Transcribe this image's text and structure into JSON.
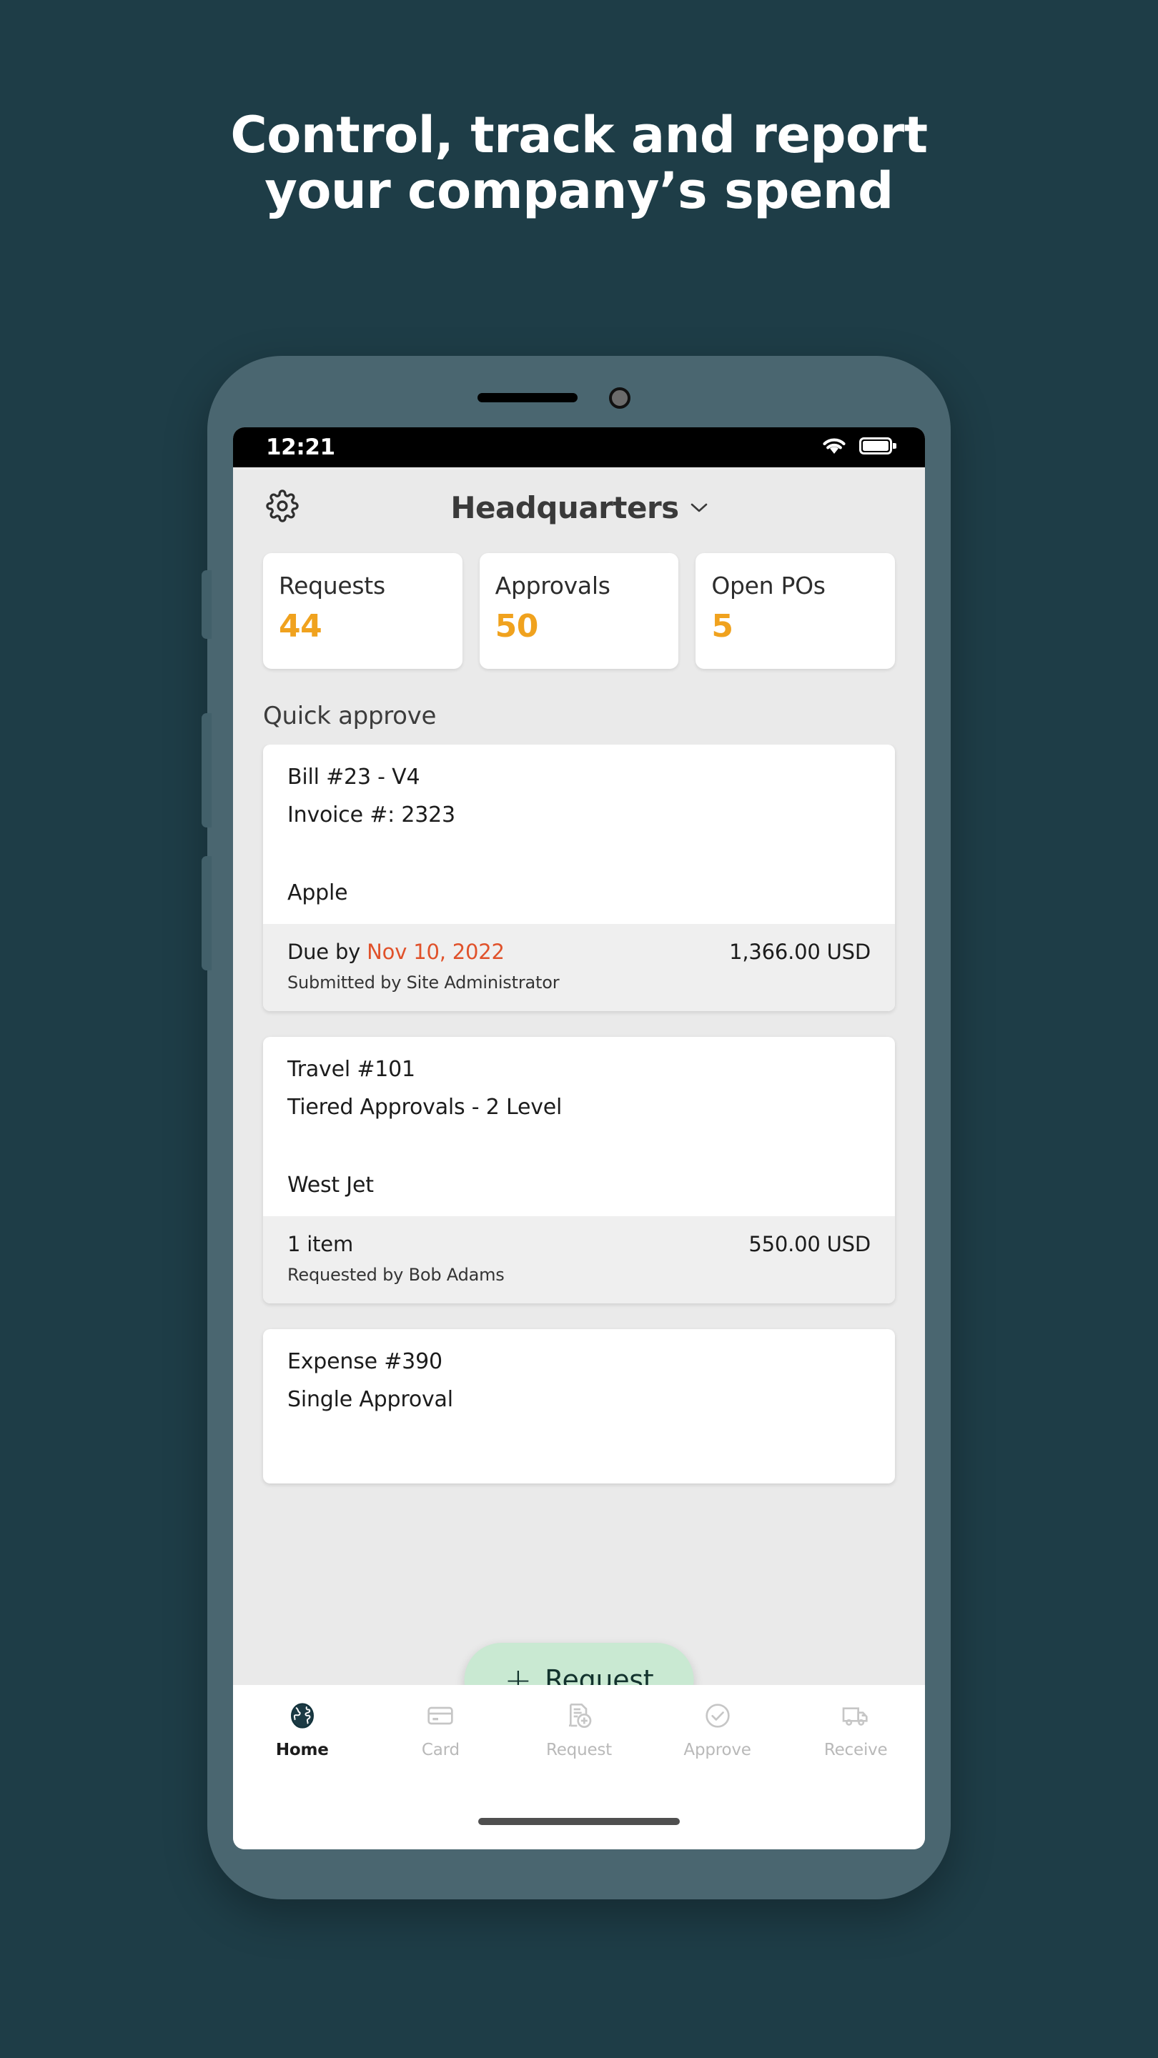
{
  "headline": {
    "line1": "Control, track and report",
    "line2": "your company’s spend"
  },
  "colors": {
    "page_background": "#1E3D47",
    "phone_frame": "#4A6670",
    "screen_background": "#EAEAEA",
    "accent_amber": "#F0A21E",
    "due_date_red": "#E0522B",
    "fab_mint": "#C9E9D2",
    "nav_active": "#1C3A44",
    "nav_inactive": "#B9B9B9"
  },
  "status_bar": {
    "time": "12:21",
    "wifi_icon": "wifi-icon",
    "battery_icon": "battery-full-icon"
  },
  "header": {
    "settings_icon": "gear-icon",
    "title": "Headquarters",
    "chevron_icon": "chevron-down-icon"
  },
  "stats": [
    {
      "label": "Requests",
      "value": "44"
    },
    {
      "label": "Approvals",
      "value": "50"
    },
    {
      "label": "Open POs",
      "value": "5"
    }
  ],
  "quick_approve": {
    "section_title": "Quick approve",
    "cards": [
      {
        "title": "Bill #23 - V4",
        "subtitle": "Invoice #: 2323",
        "vendor": "Apple",
        "meta_prefix": "Due by ",
        "meta_date": "Nov 10, 2022",
        "amount": "1,366.00 USD",
        "submitted_by": "Submitted by Site Administrator"
      },
      {
        "title": "Travel #101",
        "subtitle": "Tiered Approvals - 2 Level",
        "vendor": "West Jet",
        "meta_prefix": "1 item",
        "meta_date": "",
        "amount": "550.00 USD",
        "submitted_by": "Requested by Bob Adams"
      },
      {
        "title": "Expense #390",
        "subtitle": "Single Approval",
        "vendor": "",
        "meta_prefix": "",
        "meta_date": "",
        "amount": "",
        "submitted_by": ""
      }
    ]
  },
  "fab": {
    "plus_icon": "plus-icon",
    "label": "Request"
  },
  "bottom_nav": [
    {
      "label": "Home",
      "icon": "globe-icon",
      "active": true
    },
    {
      "label": "Card",
      "icon": "credit-card-icon",
      "active": false
    },
    {
      "label": "Request",
      "icon": "document-plus-icon",
      "active": false
    },
    {
      "label": "Approve",
      "icon": "check-circle-icon",
      "active": false
    },
    {
      "label": "Receive",
      "icon": "delivery-truck-icon",
      "active": false
    }
  ]
}
